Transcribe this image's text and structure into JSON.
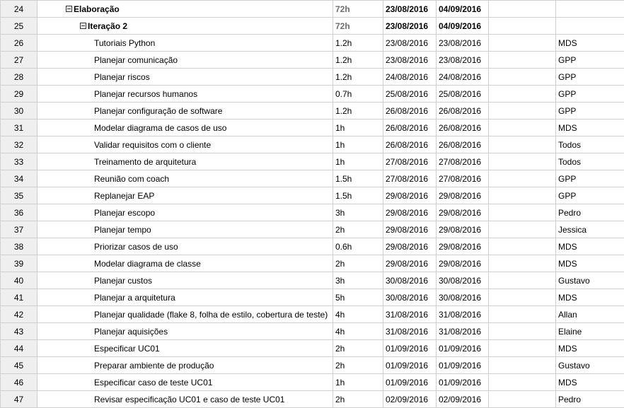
{
  "rows": [
    {
      "id": "24",
      "name": "Elaboração",
      "work": "72h",
      "start": "23/08/2016",
      "finish": "04/09/2016",
      "resource": "",
      "summary": true,
      "indent": 40
    },
    {
      "id": "25",
      "name": "Iteração 2",
      "work": "72h",
      "start": "23/08/2016",
      "finish": "04/09/2016",
      "resource": "",
      "summary": true,
      "indent": 60
    },
    {
      "id": "26",
      "name": "Tutoriais Python",
      "work": "1.2h",
      "start": "23/08/2016",
      "finish": "23/08/2016",
      "resource": "MDS"
    },
    {
      "id": "27",
      "name": "Planejar comunicação",
      "work": "1.2h",
      "start": "23/08/2016",
      "finish": "23/08/2016",
      "resource": "GPP"
    },
    {
      "id": "28",
      "name": "Planejar riscos",
      "work": "1.2h",
      "start": "24/08/2016",
      "finish": "24/08/2016",
      "resource": "GPP"
    },
    {
      "id": "29",
      "name": "Planejar recursos humanos",
      "work": "0.7h",
      "start": "25/08/2016",
      "finish": "25/08/2016",
      "resource": "GPP"
    },
    {
      "id": "30",
      "name": "Planejar configuração de software",
      "work": "1.2h",
      "start": "26/08/2016",
      "finish": "26/08/2016",
      "resource": "GPP"
    },
    {
      "id": "31",
      "name": "Modelar diagrama de casos de uso",
      "work": "1h",
      "start": "26/08/2016",
      "finish": "26/08/2016",
      "resource": "MDS"
    },
    {
      "id": "32",
      "name": "Validar requisitos com o cliente",
      "work": "1h",
      "start": "26/08/2016",
      "finish": "26/08/2016",
      "resource": "Todos"
    },
    {
      "id": "33",
      "name": "Treinamento de arquitetura",
      "work": "1h",
      "start": "27/08/2016",
      "finish": "27/08/2016",
      "resource": "Todos"
    },
    {
      "id": "34",
      "name": "Reunião com coach",
      "work": "1.5h",
      "start": "27/08/2016",
      "finish": "27/08/2016",
      "resource": "GPP"
    },
    {
      "id": "35",
      "name": "Replanejar EAP",
      "work": "1.5h",
      "start": "29/08/2016",
      "finish": "29/08/2016",
      "resource": "GPP"
    },
    {
      "id": "36",
      "name": "Planejar escopo",
      "work": "3h",
      "start": "29/08/2016",
      "finish": "29/08/2016",
      "resource": "Pedro"
    },
    {
      "id": "37",
      "name": "Planejar tempo",
      "work": "2h",
      "start": "29/08/2016",
      "finish": "29/08/2016",
      "resource": "Jessica"
    },
    {
      "id": "38",
      "name": "Priorizar casos de uso",
      "work": "0.6h",
      "start": "29/08/2016",
      "finish": "29/08/2016",
      "resource": "MDS"
    },
    {
      "id": "39",
      "name": "Modelar diagrama de classe",
      "work": "2h",
      "start": "29/08/2016",
      "finish": "29/08/2016",
      "resource": "MDS"
    },
    {
      "id": "40",
      "name": "Planejar custos",
      "work": "3h",
      "start": "30/08/2016",
      "finish": "30/08/2016",
      "resource": "Gustavo"
    },
    {
      "id": "41",
      "name": "Planejar a arquitetura",
      "work": "5h",
      "start": "30/08/2016",
      "finish": "30/08/2016",
      "resource": "MDS"
    },
    {
      "id": "42",
      "name": "Planejar qualidade (flake 8, folha de estilo, cobertura de teste)",
      "work": "4h",
      "start": "31/08/2016",
      "finish": "31/08/2016",
      "resource": "Allan"
    },
    {
      "id": "43",
      "name": "Planejar aquisições",
      "work": "4h",
      "start": "31/08/2016",
      "finish": "31/08/2016",
      "resource": "Elaine"
    },
    {
      "id": "44",
      "name": "Especificar UC01",
      "work": "2h",
      "start": "01/09/2016",
      "finish": "01/09/2016",
      "resource": "MDS"
    },
    {
      "id": "45",
      "name": "Preparar ambiente de produção",
      "work": "2h",
      "start": "01/09/2016",
      "finish": "01/09/2016",
      "resource": "Gustavo"
    },
    {
      "id": "46",
      "name": "Especificar caso de teste UC01",
      "work": "1h",
      "start": "01/09/2016",
      "finish": "01/09/2016",
      "resource": "MDS"
    },
    {
      "id": "47",
      "name": "Revisar especificação UC01 e caso de teste UC01",
      "work": "2h",
      "start": "02/09/2016",
      "finish": "02/09/2016",
      "resource": "Pedro"
    }
  ]
}
